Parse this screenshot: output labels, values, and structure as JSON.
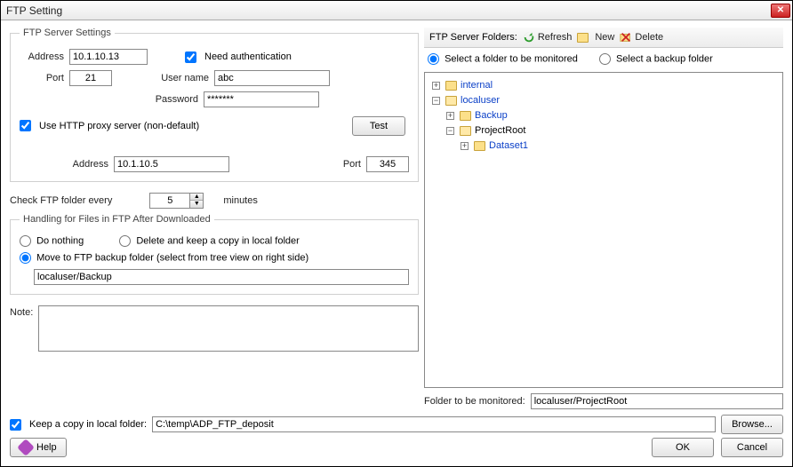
{
  "window": {
    "title": "FTP Setting"
  },
  "serverSettings": {
    "legend": "FTP Server Settings",
    "addressLabel": "Address",
    "addressValue": "10.1.10.13",
    "portLabel": "Port",
    "portValue": "21",
    "needAuthLabel": "Need authentication",
    "needAuthChecked": true,
    "userLabel": "User name",
    "userValue": "abc",
    "passLabel": "Password",
    "passValue": "*******",
    "testLabel": "Test",
    "useProxyLabel": "Use HTTP proxy server (non-default)",
    "useProxyChecked": true,
    "proxyAddressLabel": "Address",
    "proxyAddressValue": "10.1.10.5",
    "proxyPortLabel": "Port",
    "proxyPortValue": "345"
  },
  "checkEvery": {
    "prefix": "Check FTP folder every",
    "value": "5",
    "suffix": "minutes"
  },
  "handling": {
    "legend": "Handling for Files in FTP After Downloaded",
    "opt1": "Do nothing",
    "opt2": "Delete and keep a copy in local folder",
    "opt3": "Move to FTP backup folder (select from tree view on right side)",
    "selected": 3,
    "backupPath": "localuser/Backup"
  },
  "note": {
    "label": "Note:",
    "value": ""
  },
  "keepCopy": {
    "checked": true,
    "label": "Keep a copy in local folder:",
    "path": "C:\\temp\\ADP_FTP_deposit",
    "browse": "Browse..."
  },
  "rightPanel": {
    "foldersLabel": "FTP Server Folders:",
    "refresh": "Refresh",
    "new": "New",
    "delete": "Delete",
    "radioMonitor": "Select a folder to be monitored",
    "radioBackup": "Select a backup folder",
    "monitorSelected": true,
    "tree": {
      "internal": "internal",
      "localuser": "localuser",
      "backup": "Backup",
      "projectroot": "ProjectRoot",
      "dataset1": "Dataset1"
    },
    "monitorLabel": "Folder to be monitored:",
    "monitorValue": "localuser/ProjectRoot"
  },
  "buttons": {
    "help": "Help",
    "ok": "OK",
    "cancel": "Cancel"
  }
}
